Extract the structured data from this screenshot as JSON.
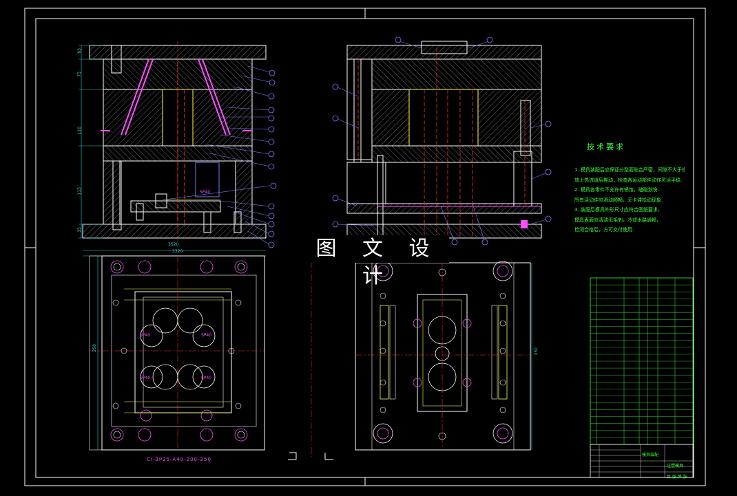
{
  "overlay_title": "图 文 设 计",
  "technical_requirements": {
    "title": "技术要求",
    "notes": [
      "1. 模具装配后应保证分型面贴合严密，间隙不大于规定值.",
      "放上热流道后推动，检查各运动部件动作灵活平稳.",
      "2. 模具各零件不允许有锈蚀，磕碰划伤.",
      "所有活动件应滑动顺畅，无卡滞松动现象.",
      "3. 装配后模具外形尺寸应符合图纸要求，",
      "模具表面应清洁无毛刺，冷却水路通畅，",
      "检测合格后，方可交付使用."
    ]
  },
  "part_code": "CI-3P25-A40-200-250",
  "dimensions": {
    "top_width": "3520",
    "inner_width": "3320",
    "height_left": "250",
    "height_right": "350",
    "stack": [
      "63",
      "75",
      "110",
      "115",
      "35"
    ]
  },
  "cavity_labels": [
    "SP40",
    "SP40",
    "SP40",
    "SP40"
  ],
  "insert_label": "SP40",
  "title_block": {
    "drawing_name": "模具装配",
    "material": "注塑模具",
    "scale": "比例",
    "sheet": "共 张 第 张"
  },
  "colors": {
    "background": "#000000",
    "frame": "#ffffff",
    "outline": "#ffffff",
    "hatch": "#ffffff",
    "centerline": "#ff3030",
    "dimension": "#2bd4d4",
    "balloon": "#7b7bff",
    "notes": "#37ff37",
    "magenta": "#ff4dff",
    "yellow": "#ffff40"
  }
}
